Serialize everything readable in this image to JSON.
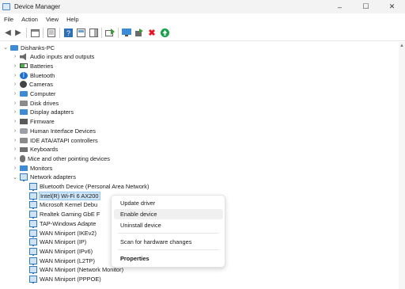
{
  "window": {
    "title": "Device Manager",
    "controls": [
      "–",
      "☐",
      "✕"
    ]
  },
  "menu": [
    "File",
    "Action",
    "View",
    "Help"
  ],
  "tree": {
    "root": "Dishanks-PC",
    "categories": [
      {
        "label": "Audio inputs and outputs",
        "icon": "speaker-icon"
      },
      {
        "label": "Batteries",
        "icon": "battery-icon"
      },
      {
        "label": "Bluetooth",
        "icon": "bluetooth-icon"
      },
      {
        "label": "Cameras",
        "icon": "camera-icon"
      },
      {
        "label": "Computer",
        "icon": "computer-icon"
      },
      {
        "label": "Disk drives",
        "icon": "disk-drive-icon"
      },
      {
        "label": "Display adapters",
        "icon": "display-adapter-icon"
      },
      {
        "label": "Firmware",
        "icon": "firmware-icon"
      },
      {
        "label": "Human Interface Devices",
        "icon": "hid-icon"
      },
      {
        "label": "IDE ATA/ATAPI controllers",
        "icon": "ide-controller-icon"
      },
      {
        "label": "Keyboards",
        "icon": "keyboard-icon"
      },
      {
        "label": "Mice and other pointing devices",
        "icon": "mouse-icon"
      },
      {
        "label": "Monitors",
        "icon": "monitor-icon"
      },
      {
        "label": "Network adapters",
        "icon": "network-adapter-icon"
      }
    ],
    "network_adapters": [
      "Bluetooth Device (Personal Area Network)",
      "Intel(R) Wi-Fi 6 AX200",
      "Microsoft Kernel Debu",
      "Realtek Gaming GbE F",
      "TAP-Windows Adapte",
      "WAN Miniport (IKEv2)",
      "WAN Miniport (IP)",
      "WAN Miniport (IPv6)",
      "WAN Miniport (L2TP)",
      "WAN Miniport (Network Monitor)",
      "WAN Miniport (PPPOE)"
    ],
    "selected": "Intel(R) Wi-Fi 6 AX200"
  },
  "context_menu": {
    "items": [
      "Update driver",
      "Enable device",
      "Uninstall device",
      "Scan for hardware changes",
      "Properties"
    ],
    "hovered": "Enable device",
    "bold": "Properties"
  },
  "colors": {
    "selection": "#cce4f7",
    "accent": "#0067c0",
    "remove": "#e81123",
    "enable": "#16a34a"
  }
}
